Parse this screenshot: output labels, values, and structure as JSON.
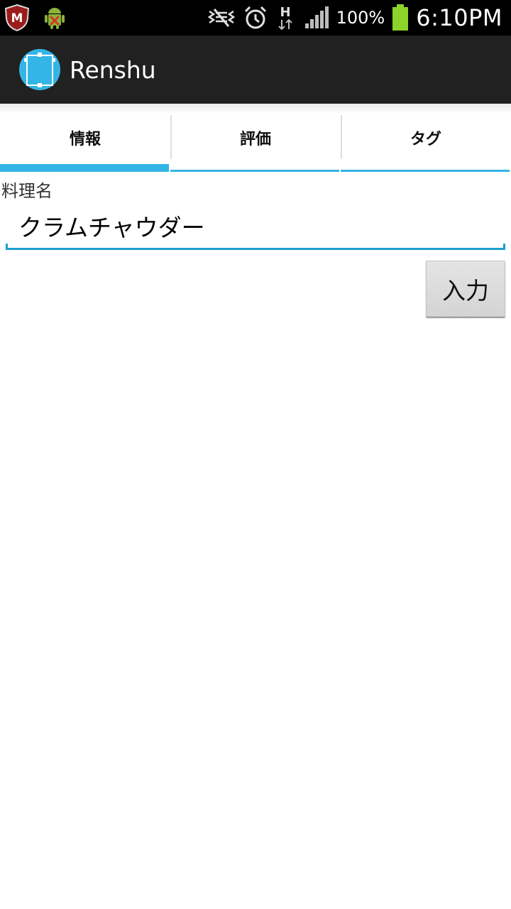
{
  "status_bar": {
    "left_icons": [
      "mcafee-icon",
      "android-debug-icon"
    ],
    "right_icons": [
      "vibrate-icon",
      "alarm-icon",
      "h-data-icon",
      "signal-icon"
    ],
    "battery_text": "100%",
    "battery_icon": "battery-full-icon",
    "time": "6:10PM"
  },
  "action_bar": {
    "app_icon": "app-launcher-icon",
    "title": "Renshu"
  },
  "tabs": [
    {
      "label": "情報",
      "selected": true
    },
    {
      "label": "評価",
      "selected": false
    },
    {
      "label": "タグ",
      "selected": false
    }
  ],
  "form": {
    "field_label": "料理名",
    "dish_name_value": "クラムチャウダー",
    "submit_label": "入力"
  },
  "colors": {
    "accent": "#33b5e5",
    "action_bar": "#212121",
    "status_bar": "#000000",
    "battery": "#8cd32a"
  }
}
